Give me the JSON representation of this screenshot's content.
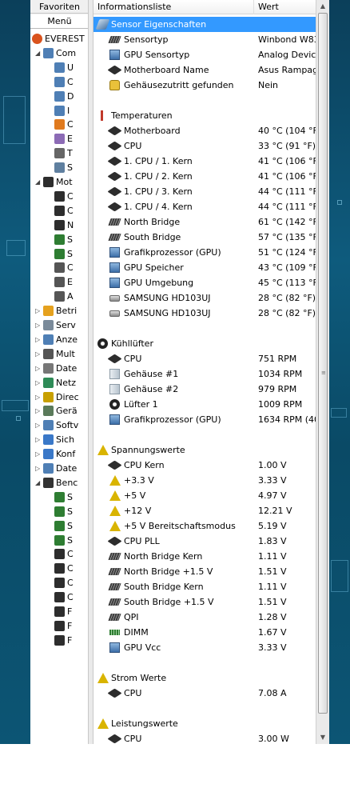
{
  "left_tabs": {
    "favorites": "Favoriten",
    "menu": "Menü"
  },
  "tree": [
    {
      "label": "EVEREST",
      "level": 0,
      "icon": "info-icon",
      "color": "#d9531e"
    },
    {
      "label": "Com",
      "level": 1,
      "icon": "computer-icon",
      "color": "#4f7fb5",
      "exp": "◢"
    },
    {
      "label": "U",
      "level": 2,
      "icon": "computer-icon",
      "color": "#4f7fb5"
    },
    {
      "label": "C",
      "level": 2,
      "icon": "computer-icon",
      "color": "#4f7fb5"
    },
    {
      "label": "D",
      "level": 2,
      "icon": "computer-icon",
      "color": "#4f7fb5"
    },
    {
      "label": "I",
      "level": 2,
      "icon": "info-icon",
      "color": "#4f7fb5"
    },
    {
      "label": "C",
      "level": 2,
      "icon": "overclock-icon",
      "color": "#e07a1e"
    },
    {
      "label": "E",
      "level": 2,
      "icon": "power-icon",
      "color": "#8c6bb5"
    },
    {
      "label": "T",
      "level": 2,
      "icon": "laptop-icon",
      "color": "#666666"
    },
    {
      "label": "S",
      "level": 2,
      "icon": "sensor-icon",
      "color": "#5f7f9f"
    },
    {
      "label": "Mot",
      "level": 1,
      "icon": "motherboard-icon",
      "color": "#2d2d2d",
      "exp": "◢"
    },
    {
      "label": "C",
      "level": 2,
      "icon": "cpu-icon",
      "color": "#2d2d2d"
    },
    {
      "label": "C",
      "level": 2,
      "icon": "cpu-icon",
      "color": "#2d2d2d"
    },
    {
      "label": "N",
      "level": 2,
      "icon": "motherboard-icon",
      "color": "#2d2d2d"
    },
    {
      "label": "S",
      "level": 2,
      "icon": "ram-icon",
      "color": "#2e7d32"
    },
    {
      "label": "S",
      "level": 2,
      "icon": "ram-icon",
      "color": "#2e7d32"
    },
    {
      "label": "C",
      "level": 2,
      "icon": "chipset-icon",
      "color": "#555555"
    },
    {
      "label": "E",
      "level": 2,
      "icon": "bios-icon",
      "color": "#555555"
    },
    {
      "label": "A",
      "level": 2,
      "icon": "acpi-icon",
      "color": "#555555"
    },
    {
      "label": "Betri",
      "level": 1,
      "icon": "windows-icon",
      "color": "#e5a11e",
      "exp": "▷"
    },
    {
      "label": "Serv",
      "level": 1,
      "icon": "server-icon",
      "color": "#7a8a9a",
      "exp": "▷"
    },
    {
      "label": "Anze",
      "level": 1,
      "icon": "display-icon",
      "color": "#4f7fb5",
      "exp": "▷"
    },
    {
      "label": "Mult",
      "level": 1,
      "icon": "multimedia-icon",
      "color": "#555555",
      "exp": "▷"
    },
    {
      "label": "Date",
      "level": 1,
      "icon": "storage-icon",
      "color": "#777777",
      "exp": "▷"
    },
    {
      "label": "Netz",
      "level": 1,
      "icon": "network-icon",
      "color": "#2e8b57",
      "exp": "▷"
    },
    {
      "label": "Direc",
      "level": 1,
      "icon": "directx-icon",
      "color": "#c8a000",
      "exp": "▷"
    },
    {
      "label": "Gerä",
      "level": 1,
      "icon": "devices-icon",
      "color": "#5a7a5a",
      "exp": "▷"
    },
    {
      "label": "Softv",
      "level": 1,
      "icon": "software-icon",
      "color": "#4f7fb5",
      "exp": "▷"
    },
    {
      "label": "Sich",
      "level": 1,
      "icon": "security-icon",
      "color": "#3a78c8",
      "exp": "▷"
    },
    {
      "label": "Konf",
      "level": 1,
      "icon": "config-icon",
      "color": "#3a78c8",
      "exp": "▷"
    },
    {
      "label": "Date",
      "level": 1,
      "icon": "database-icon",
      "color": "#4f7fb5",
      "exp": "▷"
    },
    {
      "label": "Benc",
      "level": 1,
      "icon": "benchmark-icon",
      "color": "#333333",
      "exp": "◢"
    },
    {
      "label": "S",
      "level": 2,
      "icon": "ram-icon",
      "color": "#2e7d32"
    },
    {
      "label": "S",
      "level": 2,
      "icon": "ram-icon",
      "color": "#2e7d32"
    },
    {
      "label": "S",
      "level": 2,
      "icon": "ram-icon",
      "color": "#2e7d32"
    },
    {
      "label": "S",
      "level": 2,
      "icon": "ram-icon",
      "color": "#2e7d32"
    },
    {
      "label": "C",
      "level": 2,
      "icon": "cpu-icon",
      "color": "#2d2d2d"
    },
    {
      "label": "C",
      "level": 2,
      "icon": "cpu-icon",
      "color": "#2d2d2d"
    },
    {
      "label": "C",
      "level": 2,
      "icon": "cpu-icon",
      "color": "#2d2d2d"
    },
    {
      "label": "C",
      "level": 2,
      "icon": "cpu-icon",
      "color": "#2d2d2d"
    },
    {
      "label": "F",
      "level": 2,
      "icon": "fpu-icon",
      "color": "#2d2d2d"
    },
    {
      "label": "F",
      "level": 2,
      "icon": "fpu-icon",
      "color": "#2d2d2d"
    },
    {
      "label": "F",
      "level": 2,
      "icon": "fpu-icon",
      "color": "#2d2d2d"
    }
  ],
  "columns": {
    "name": "Informationsliste",
    "value": "Wert"
  },
  "rows": [
    {
      "type": "group",
      "name": "Sensor Eigenschaften",
      "icon": "sensor-icon",
      "selected": true
    },
    {
      "type": "item",
      "name": "Sensortyp",
      "value": "Winbond W83",
      "icon": "chip-icon"
    },
    {
      "type": "item",
      "name": "GPU Sensortyp",
      "value": "Analog Devic",
      "icon": "gpu-icon"
    },
    {
      "type": "item",
      "name": "Motherboard Name",
      "value": "Asus Rampag",
      "icon": "motherboard-icon"
    },
    {
      "type": "item",
      "name": "Gehäusezutritt gefunden",
      "value": "Nein",
      "icon": "lock-icon"
    },
    {
      "type": "blank"
    },
    {
      "type": "group",
      "name": "Temperaturen",
      "icon": "thermometer-icon"
    },
    {
      "type": "item",
      "name": "Motherboard",
      "value": "40 °C  (104 °F",
      "icon": "motherboard-icon"
    },
    {
      "type": "item",
      "name": "CPU",
      "value": "33 °C  (91 °F)",
      "icon": "cpu-icon"
    },
    {
      "type": "item",
      "name": "1. CPU / 1. Kern",
      "value": "41 °C  (106 °F",
      "icon": "cpu-icon"
    },
    {
      "type": "item",
      "name": "1. CPU / 2. Kern",
      "value": "41 °C  (106 °F",
      "icon": "cpu-icon"
    },
    {
      "type": "item",
      "name": "1. CPU / 3. Kern",
      "value": "44 °C  (111 °F",
      "icon": "cpu-icon"
    },
    {
      "type": "item",
      "name": "1. CPU / 4. Kern",
      "value": "44 °C  (111 °F",
      "icon": "cpu-icon"
    },
    {
      "type": "item",
      "name": "North Bridge",
      "value": "61 °C  (142 °F",
      "icon": "chip-icon"
    },
    {
      "type": "item",
      "name": "South Bridge",
      "value": "57 °C  (135 °F",
      "icon": "chip-icon"
    },
    {
      "type": "item",
      "name": "Grafikprozessor (GPU)",
      "value": "51 °C  (124 °F",
      "icon": "gpu-icon"
    },
    {
      "type": "item",
      "name": "GPU Speicher",
      "value": "43 °C  (109 °F",
      "icon": "gpu-icon"
    },
    {
      "type": "item",
      "name": "GPU Umgebung",
      "value": "45 °C  (113 °F",
      "icon": "gpu-icon"
    },
    {
      "type": "item",
      "name": "SAMSUNG HD103UJ",
      "value": "28 °C  (82 °F)",
      "icon": "hdd-icon"
    },
    {
      "type": "item",
      "name": "SAMSUNG HD103UJ",
      "value": "28 °C  (82 °F)",
      "icon": "hdd-icon"
    },
    {
      "type": "blank"
    },
    {
      "type": "group",
      "name": "Kühllüfter",
      "icon": "fan-icon"
    },
    {
      "type": "item",
      "name": "CPU",
      "value": "751 RPM",
      "icon": "cpu-icon"
    },
    {
      "type": "item",
      "name": "Gehäuse #1",
      "value": "1034 RPM",
      "icon": "case-icon"
    },
    {
      "type": "item",
      "name": "Gehäuse #2",
      "value": "979 RPM",
      "icon": "case-icon"
    },
    {
      "type": "item",
      "name": "Lüfter 1",
      "value": "1009 RPM",
      "icon": "fan-icon"
    },
    {
      "type": "item",
      "name": "Grafikprozessor (GPU)",
      "value": "1634 RPM  (40",
      "icon": "gpu-icon"
    },
    {
      "type": "blank"
    },
    {
      "type": "group",
      "name": "Spannungswerte",
      "icon": "warning-icon"
    },
    {
      "type": "item",
      "name": "CPU Kern",
      "value": "1.00 V",
      "icon": "cpu-icon"
    },
    {
      "type": "item",
      "name": "+3.3 V",
      "value": "3.33 V",
      "icon": "warning-icon"
    },
    {
      "type": "item",
      "name": "+5 V",
      "value": "4.97 V",
      "icon": "warning-icon"
    },
    {
      "type": "item",
      "name": "+12 V",
      "value": "12.21 V",
      "icon": "warning-icon"
    },
    {
      "type": "item",
      "name": "+5 V Bereitschaftsmodus",
      "value": "5.19 V",
      "icon": "warning-icon"
    },
    {
      "type": "item",
      "name": "CPU PLL",
      "value": "1.83 V",
      "icon": "cpu-icon"
    },
    {
      "type": "item",
      "name": "North Bridge Kern",
      "value": "1.11 V",
      "icon": "chip-icon"
    },
    {
      "type": "item",
      "name": "North Bridge +1.5 V",
      "value": "1.51 V",
      "icon": "chip-icon"
    },
    {
      "type": "item",
      "name": "South Bridge Kern",
      "value": "1.11 V",
      "icon": "chip-icon"
    },
    {
      "type": "item",
      "name": "South Bridge +1.5 V",
      "value": "1.51 V",
      "icon": "chip-icon"
    },
    {
      "type": "item",
      "name": "QPI",
      "value": "1.28 V",
      "icon": "chip-icon"
    },
    {
      "type": "item",
      "name": "DIMM",
      "value": "1.67 V",
      "icon": "ram-icon"
    },
    {
      "type": "item",
      "name": "GPU Vcc",
      "value": "3.33 V",
      "icon": "gpu-icon"
    },
    {
      "type": "blank"
    },
    {
      "type": "group",
      "name": "Strom Werte",
      "icon": "warning-icon"
    },
    {
      "type": "item",
      "name": "CPU",
      "value": "7.08 A",
      "icon": "cpu-icon"
    },
    {
      "type": "blank"
    },
    {
      "type": "group",
      "name": "Leistungswerte",
      "icon": "warning-icon"
    },
    {
      "type": "item",
      "name": "CPU",
      "value": "3.00 W",
      "icon": "cpu-icon"
    }
  ]
}
